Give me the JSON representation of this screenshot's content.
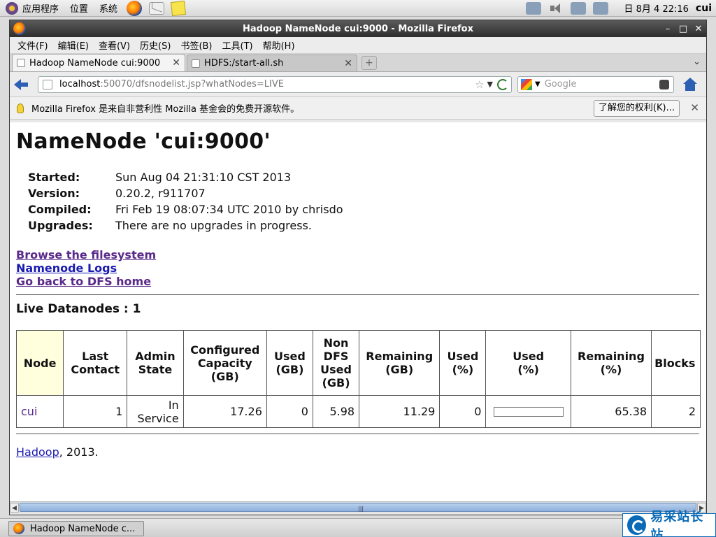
{
  "panel": {
    "menus": [
      "应用程序",
      "位置",
      "系统"
    ],
    "clock": "日 8月  4 22:16",
    "user": "cui"
  },
  "window": {
    "title": "Hadoop NameNode cui:9000 - Mozilla Firefox",
    "controls": [
      "–",
      "□",
      "✕"
    ]
  },
  "menubar": [
    "文件(F)",
    "编辑(E)",
    "查看(V)",
    "历史(S)",
    "书签(B)",
    "工具(T)",
    "帮助(H)"
  ],
  "tabs": [
    {
      "label": "Hadoop NameNode cui:9000",
      "active": true
    },
    {
      "label": "HDFS:/start-all.sh",
      "active": false
    }
  ],
  "tabbar": {
    "newtab": "+",
    "list": "⌄",
    "close": "✕"
  },
  "navbar": {
    "url_host": "localhost",
    "url_rest": ":50070/dfsnodelist.jsp?whatNodes=LIVE",
    "search_placeholder": "Google"
  },
  "notification": {
    "text": "Mozilla Firefox 是来自非营利性 Mozilla 基金会的免费开源软件。",
    "button": "了解您的权利(K)...",
    "close": "✕"
  },
  "page": {
    "heading": "NameNode 'cui:9000'",
    "info": [
      {
        "k": "Started:",
        "v": "Sun Aug 04 21:31:10 CST 2013"
      },
      {
        "k": "Version:",
        "v": "0.20.2, r911707"
      },
      {
        "k": "Compiled:",
        "v": "Fri Feb 19 08:07:34 UTC 2010 by chrisdo"
      },
      {
        "k": "Upgrades:",
        "v": "There are no upgrades in progress."
      }
    ],
    "links": [
      "Browse the filesystem",
      "Namenode Logs",
      "Go back to DFS home"
    ],
    "live_title": "Live Datanodes : 1",
    "table": {
      "headers": [
        "Node",
        "Last Contact",
        "Admin State",
        "Configured Capacity (GB)",
        "Used (GB)",
        "Non DFS Used (GB)",
        "Remaining (GB)",
        "Used (%)",
        "Used (%)",
        "Remaining (%)",
        "Blocks"
      ],
      "header_lines": [
        [
          "Node"
        ],
        [
          "Last",
          "Contact"
        ],
        [
          "Admin",
          "State"
        ],
        [
          "Configured",
          "Capacity",
          "(GB)"
        ],
        [
          "Used",
          "(GB)"
        ],
        [
          "Non",
          "DFS",
          "Used",
          "(GB)"
        ],
        [
          "Remaining",
          "(GB)"
        ],
        [
          "Used",
          "(%)"
        ],
        [
          "Used",
          "(%)"
        ],
        [
          "Remaining",
          "(%)"
        ],
        [
          "Blocks"
        ]
      ],
      "row": {
        "node": "cui",
        "last_contact": "1",
        "admin_state": "In Service",
        "configured_capacity": "17.26",
        "used_gb": "0",
        "non_dfs_used": "5.98",
        "remaining_gb": "11.29",
        "used_pct": "0",
        "used_bar": 0,
        "remaining_pct": "65.38",
        "blocks": "2"
      }
    },
    "footer_link": "Hadoop",
    "footer_rest": ", 2013."
  },
  "taskbar": {
    "item": "Hadoop NameNode c..."
  },
  "watermark": "易采站长站"
}
